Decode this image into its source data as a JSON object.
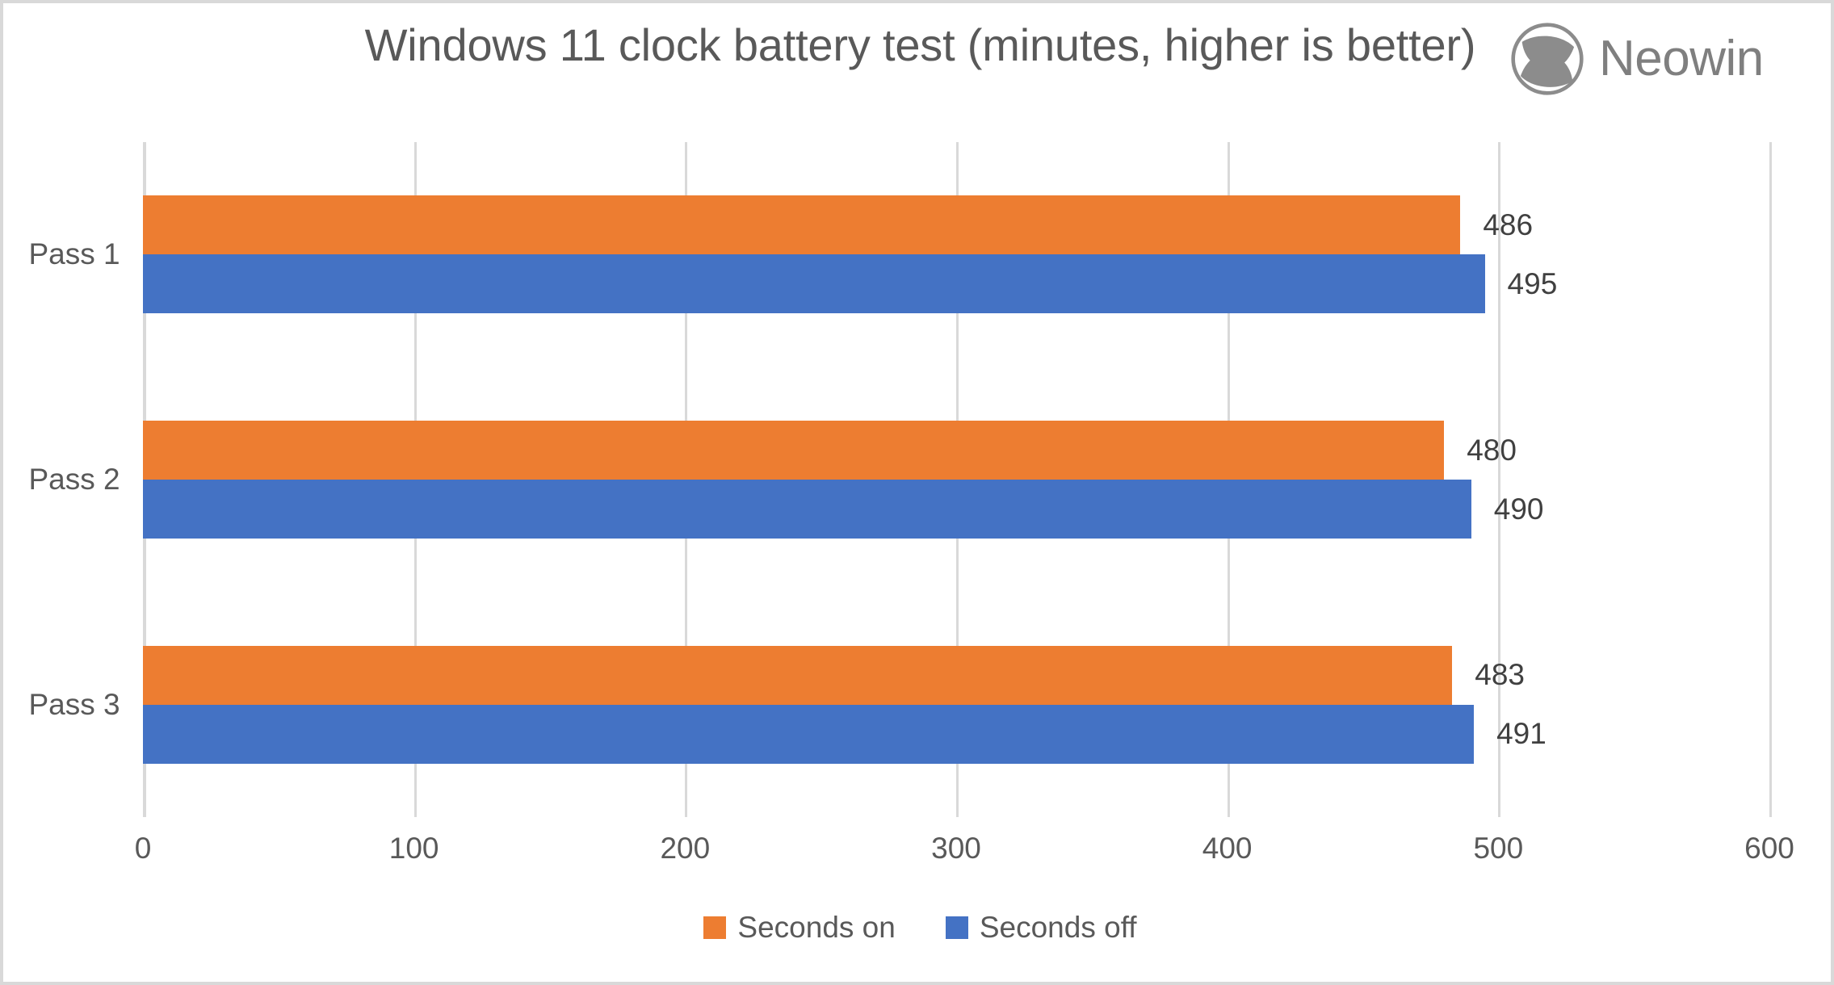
{
  "chart_data": {
    "type": "bar",
    "orientation": "horizontal",
    "title": "Windows 11 clock battery test (minutes, higher is better)",
    "xlabel": "",
    "ylabel": "",
    "categories": [
      "Pass 1",
      "Pass 2",
      "Pass 3"
    ],
    "series": [
      {
        "name": "Seconds on",
        "color": "#ED7D31",
        "values": [
          486,
          480,
          483
        ]
      },
      {
        "name": "Seconds off",
        "color": "#4472C4",
        "values": [
          495,
          490,
          491
        ]
      }
    ],
    "xlim": [
      0,
      600
    ],
    "xticks": [
      0,
      100,
      200,
      300,
      400,
      500,
      600
    ],
    "xtick_labels": [
      "0",
      "100",
      "200",
      "300",
      "400",
      "500",
      "600"
    ],
    "grid": true,
    "grid_axis": "x",
    "legend_position": "bottom",
    "data_labels": [
      [
        "486",
        "495"
      ],
      [
        "480",
        "490"
      ],
      [
        "483",
        "491"
      ]
    ]
  },
  "watermark": {
    "brand": "Neowin",
    "mark_icon": "neowin-circle-icon",
    "color": "#7F7F7F"
  },
  "style": {
    "title_color": "#595959",
    "axis_text_color": "#595959",
    "data_label_color": "#404040",
    "gridline_color": "#D9D9D9",
    "plot_background": "#FFFFFF",
    "border_color": "#D9D9D9"
  }
}
